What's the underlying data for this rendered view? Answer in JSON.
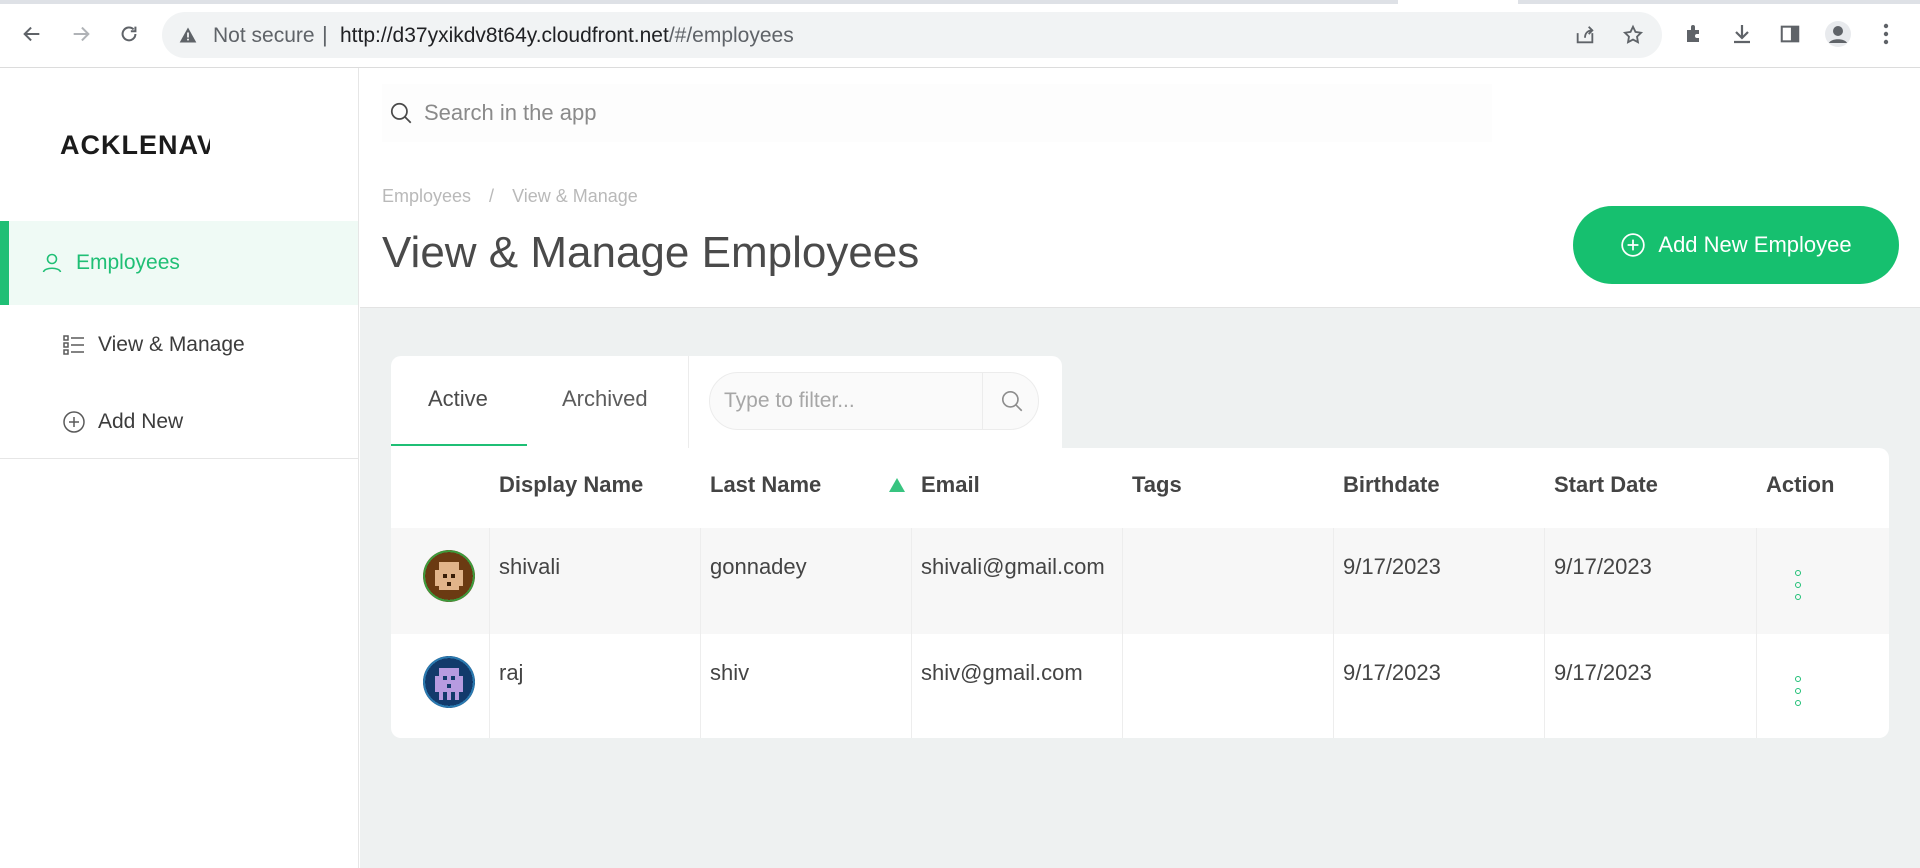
{
  "browser": {
    "security_label": "Not secure",
    "url_host": "http://d37yxikdv8t64y.cloudfront.net",
    "url_path": "/#/employees",
    "icons": [
      "back-arrow-icon",
      "forward-arrow-icon",
      "reload-icon",
      "warning-icon",
      "share-icon",
      "star-icon",
      "puzzle-icon",
      "download-icon",
      "sidepanel-icon",
      "profile-icon",
      "more-vert-icon"
    ]
  },
  "sidebar": {
    "logo_text": "ACKLENAVE",
    "items": [
      {
        "label": "Employees",
        "icon": "user-icon",
        "active": true
      },
      {
        "label": "View & Manage",
        "icon": "list-icon",
        "active": false
      },
      {
        "label": "Add New",
        "icon": "plus-circle-icon",
        "active": false
      }
    ]
  },
  "header": {
    "search_placeholder": "Search in the app",
    "breadcrumb": [
      "Employees",
      "View & Manage"
    ],
    "breadcrumb_separator": "/",
    "title": "View & Manage Employees",
    "add_button_label": "Add New Employee"
  },
  "tabs": {
    "items": [
      "Active",
      "Archived"
    ],
    "active_index": 0,
    "filter_placeholder": "Type to filter..."
  },
  "table": {
    "columns": [
      "Display Name",
      "Last Name",
      "Email",
      "Tags",
      "Birthdate",
      "Start Date",
      "Action"
    ],
    "sorted_column": "Email",
    "sort_direction": "ascending",
    "rows": [
      {
        "display_name": "shivali",
        "last_name": "gonnadey",
        "email": "shivali@gmail.com",
        "tags": "",
        "birthdate": "9/17/2023",
        "start_date": "9/17/2023"
      },
      {
        "display_name": "raj",
        "last_name": "shiv",
        "email": "shiv@gmail.com",
        "tags": "",
        "birthdate": "9/17/2023",
        "start_date": "9/17/2023"
      }
    ]
  },
  "colors": {
    "accent": "#1fbf75",
    "button": "#16c06f",
    "content_bg": "#eef1f1"
  }
}
